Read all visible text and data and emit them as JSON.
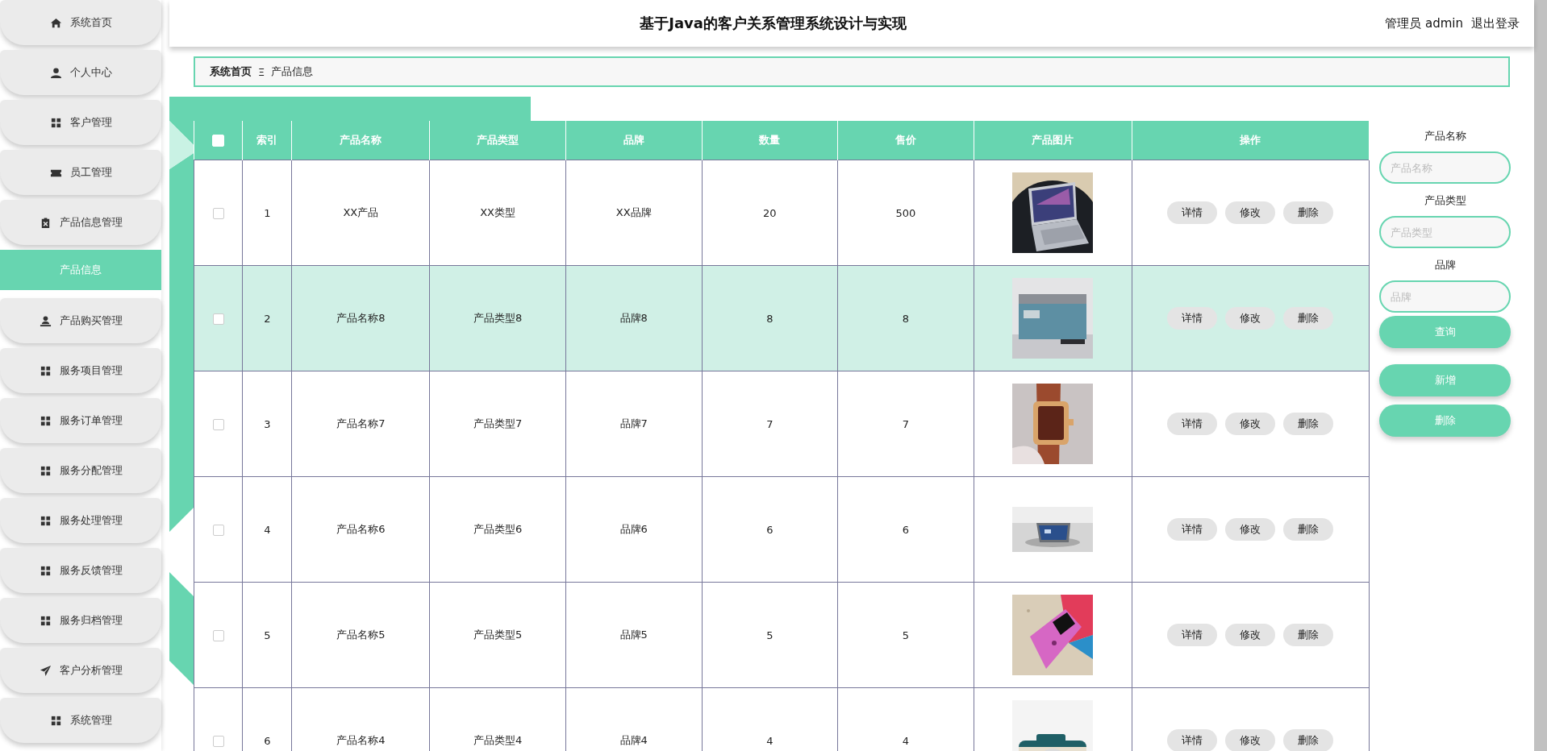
{
  "sidebar": {
    "items": [
      {
        "label": "系统首页",
        "selected": false
      },
      {
        "label": "个人中心",
        "selected": false
      },
      {
        "label": "客户管理",
        "selected": false
      },
      {
        "label": "员工管理",
        "selected": false
      },
      {
        "label": "产品信息管理",
        "selected": false
      },
      {
        "label": "产品信息",
        "selected": true
      },
      {
        "label": "产品购买管理",
        "selected": false
      },
      {
        "label": "服务项目管理",
        "selected": false
      },
      {
        "label": "服务订单管理",
        "selected": false
      },
      {
        "label": "服务分配管理",
        "selected": false
      },
      {
        "label": "服务处理管理",
        "selected": false
      },
      {
        "label": "服务反馈管理",
        "selected": false
      },
      {
        "label": "服务归档管理",
        "selected": false
      },
      {
        "label": "客户分析管理",
        "selected": false
      },
      {
        "label": "系统管理",
        "selected": false
      }
    ]
  },
  "header": {
    "title": "基于Java的客户关系管理系统设计与实现",
    "user": "管理员 admin",
    "logout": "退出登录"
  },
  "breadcrumb": {
    "items": [
      "系统首页",
      "产品信息"
    ],
    "separator": "Ξ"
  },
  "table": {
    "select_all": {
      "checked": false
    },
    "columns": [
      "索引",
      "产品名称",
      "产品类型",
      "品牌",
      "数量",
      "售价",
      "产品图片",
      "操作"
    ],
    "rows": [
      {
        "checked": false,
        "hovered": false,
        "cells": [
          "1",
          "XX产品",
          "XX类型",
          "XX品牌",
          "20",
          "500"
        ],
        "actions": [
          "详情",
          "修改",
          "删除"
        ]
      },
      {
        "checked": false,
        "hovered": true,
        "cells": [
          "2",
          "产品名称8",
          "产品类型8",
          "品牌8",
          "8",
          "8"
        ],
        "actions": [
          "详情",
          "修改",
          "删除"
        ]
      },
      {
        "checked": false,
        "hovered": false,
        "cells": [
          "3",
          "产品名称7",
          "产品类型7",
          "品牌7",
          "7",
          "7"
        ],
        "actions": [
          "详情",
          "修改",
          "删除"
        ]
      },
      {
        "checked": false,
        "hovered": false,
        "cells": [
          "4",
          "产品名称6",
          "产品类型6",
          "品牌6",
          "6",
          "6"
        ],
        "actions": [
          "详情",
          "修改",
          "删除"
        ]
      },
      {
        "checked": false,
        "hovered": false,
        "cells": [
          "5",
          "产品名称5",
          "产品类型5",
          "品牌5",
          "5",
          "5"
        ],
        "actions": [
          "详情",
          "修改",
          "删除"
        ]
      },
      {
        "checked": false,
        "hovered": false,
        "cells": [
          "6",
          "产品名称4",
          "产品类型4",
          "品牌4",
          "4",
          "4"
        ],
        "actions": [
          "详情",
          "修改",
          "删除"
        ]
      }
    ]
  },
  "search": {
    "fields": [
      {
        "label": "产品名称",
        "placeholder": "产品名称"
      },
      {
        "label": "产品类型",
        "placeholder": "产品类型"
      },
      {
        "label": "品牌",
        "placeholder": "品牌"
      }
    ],
    "query_button": "查询",
    "buttons": [
      "新增",
      "删除"
    ]
  }
}
